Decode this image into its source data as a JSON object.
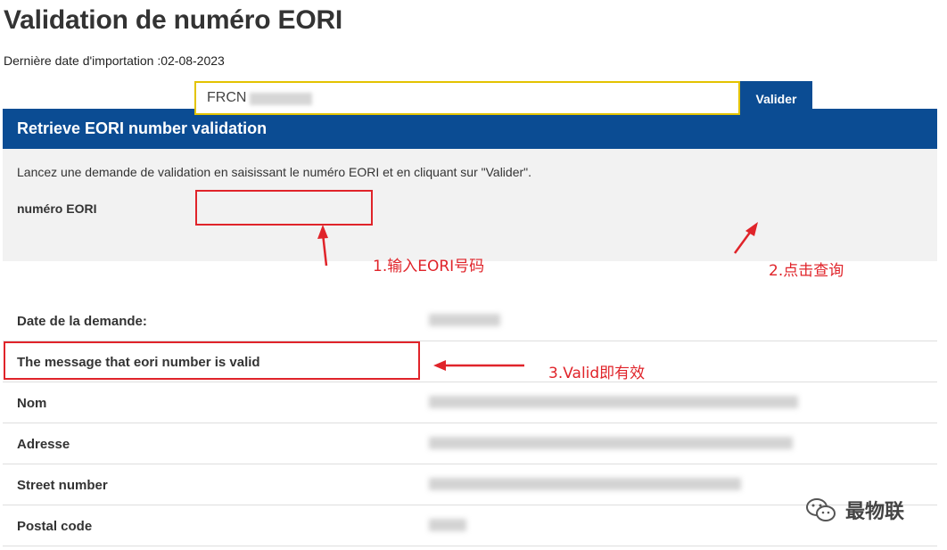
{
  "page": {
    "title": "Validation de numéro EORI",
    "import_date": "Dernière date d'importation :02-08-2023"
  },
  "form": {
    "header": "Retrieve EORI number validation",
    "description": "Lancez une demande de validation en saisissant le numéro EORI et en cliquant sur \"Valider\".",
    "eori_label": "numéro EORI",
    "eori_value": "FRCN",
    "validate_label": "Valider"
  },
  "results": {
    "rows": [
      {
        "label": "Date de la demande:"
      },
      {
        "label": "The message that eori number is valid"
      },
      {
        "label": "Nom"
      },
      {
        "label": "Adresse"
      },
      {
        "label": "Street number"
      },
      {
        "label": "Postal code"
      }
    ]
  },
  "annotations": {
    "step1": "1.输入EORI号码",
    "step2": "2.点击查询",
    "step3": "3.Valid即有效",
    "color": "#e0242a"
  },
  "watermark": {
    "text": "最物联",
    "icon": "wechat-icon"
  },
  "colors": {
    "header_blue": "#0b4c93",
    "input_border": "#e3c300",
    "panel_bg": "#f2f2f2"
  }
}
